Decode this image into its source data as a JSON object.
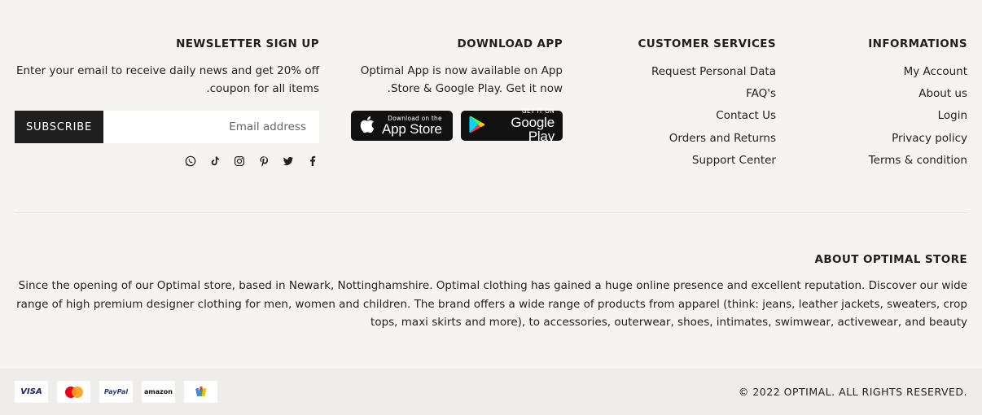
{
  "informations": {
    "title": "INFORMATIONS",
    "links": [
      "My Account",
      "About us",
      "Login",
      "Privacy policy",
      "Terms & condition"
    ]
  },
  "customer_services": {
    "title": "CUSTOMER SERVICES",
    "links": [
      "Request Personal Data",
      "FAQ's",
      "Contact Us",
      "Orders and Returns",
      "Support Center"
    ]
  },
  "download_app": {
    "title": "DOWNLOAD APP",
    "text": "Optimal App is now available on App Store & Google Play. Get it now.",
    "appstore_small": "Download on the",
    "appstore_big": "App Store",
    "gplay_small": "GET IT ON",
    "gplay_big": "Google Play"
  },
  "newsletter": {
    "title": "NEWSLETTER SIGN UP",
    "text": "Enter your email to receive daily news and get 20% off coupon for all items.",
    "button_label": "SUBSCRIBE",
    "email_placeholder": "Email address",
    "socials": [
      "facebook-icon",
      "twitter-icon",
      "pinterest-icon",
      "instagram-icon",
      "tiktok-icon",
      "whatsapp-icon"
    ]
  },
  "about": {
    "title": "ABOUT OPTIMAL STORE",
    "text": "Since the opening of our Optimal store, based in Newark, Nottinghamshire. Optimal clothing has gained a huge online presence and excellent reputation. Discover our wide range of high premium designer clothing for men, women and children. The brand offers a wide range of products from apparel (think: jeans, leather jackets, sweaters, crop tops, maxi skirts and more), to accessories, outerwear, shoes, intimates, swimwear, activewear, and beauty"
  },
  "payments": [
    "VISA",
    "MasterCard",
    "PayPal",
    "amazon",
    "Google Wallet"
  ],
  "copyright": "© 2022 OPTIMAL. ALL RIGHTS RESERVED."
}
